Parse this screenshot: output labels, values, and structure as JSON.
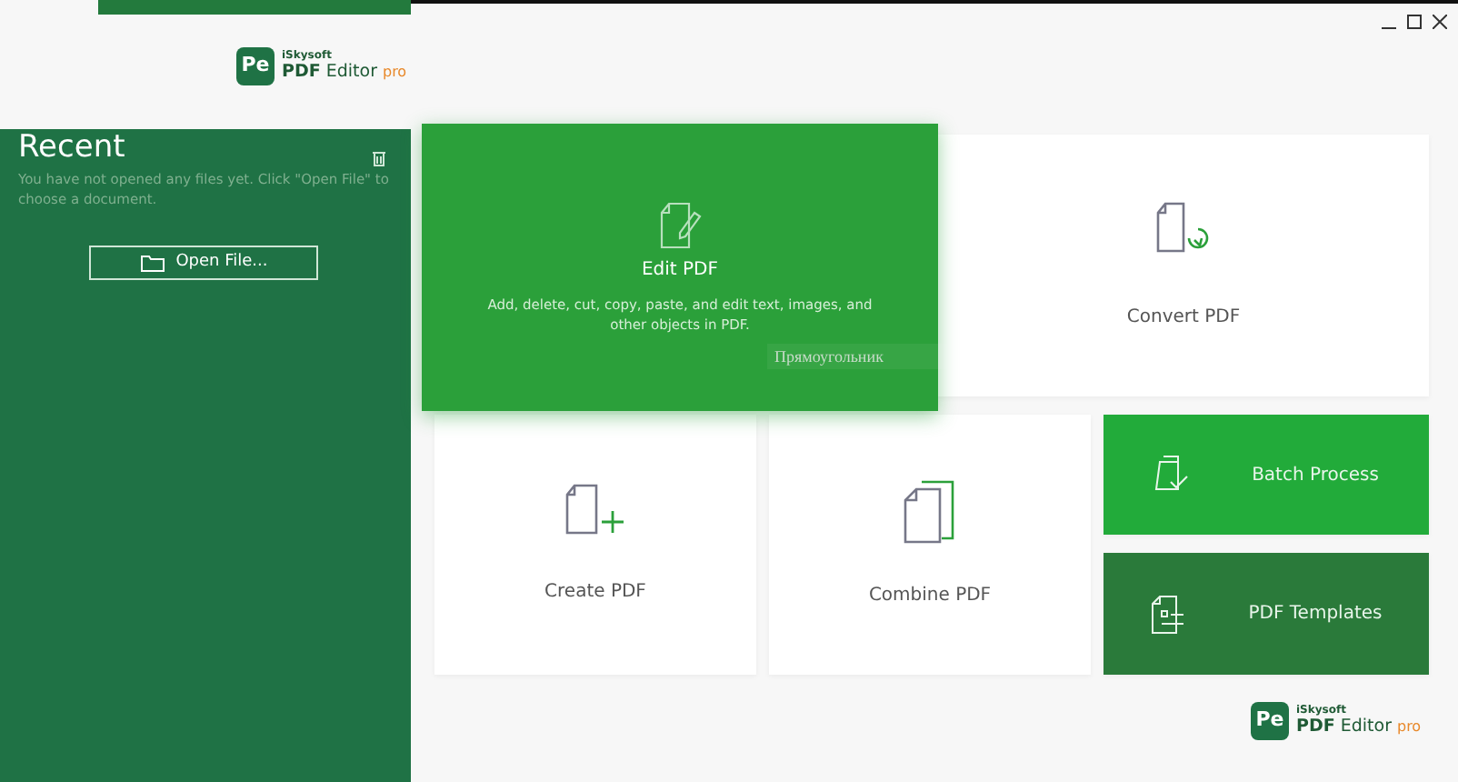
{
  "top_panel": {
    "logo": {
      "badge": "Pe",
      "brand": "iSkysoft",
      "product": "**PDF** Editor",
      "edition": "pro"
    }
  },
  "recent": {
    "title": "Recent",
    "message": "You have not opened any files yet. Click \"Open File\" to choose a document.",
    "open_button": "Open File..."
  },
  "tiles": [
    {
      "kind": "featured",
      "label": "Edit PDF",
      "description": "Add, delete, cut, copy, paste, and edit text, images, and other objects in PDF."
    },
    {
      "kind": "large",
      "label": "Convert PDF"
    },
    {
      "kind": "plain",
      "label": "Create PDF"
    },
    {
      "kind": "plain",
      "label": "Combine PDF"
    },
    {
      "kind": "accent",
      "label": "Batch Process"
    },
    {
      "kind": "dark",
      "label": "PDF Templates"
    }
  ],
  "overlay_label": "Прямоугольник",
  "footer_logo": {
    "badge": "Pe",
    "brand": "iSkysoft",
    "product": "**PDF** Editor",
    "edition": "pro"
  }
}
